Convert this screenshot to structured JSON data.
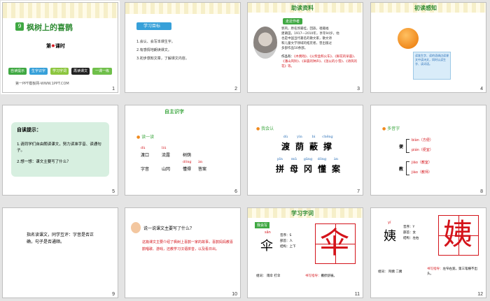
{
  "slides": [
    {
      "number": "1",
      "title_num": "9",
      "title": "枫树上的喜鹊",
      "lesson_pre": "第",
      "lesson_post": "课时",
      "leaf_icon": "maple-leaf-icon",
      "nav": [
        "自读提示",
        "生字识字",
        "学习字词",
        "再读课文",
        "一课一练"
      ],
      "footer": "第一PPT模板网-WWW.1PPT.COM"
    },
    {
      "number": "2",
      "heading": "学习目标",
      "lines": [
        "1.会认、会写本课生字。",
        "2.有感情地朗读课文。",
        "3.初步感知文章，了解课文内容。"
      ]
    },
    {
      "number": "3",
      "header": "助读资料",
      "tag": "走近作者",
      "bio": [
        "郭风，原名郭嘉桂，回族，祖籍福",
        "建莆田，1917—2010年，享年94岁，他",
        "也是中国当代著名的散文家，散文诗",
        "和儿童文学领域的拓荒者，曾出版过",
        "多部作品50余部。"
      ],
      "works_label": "作品有：",
      "works": "《木偶戏》、《火柴盒和火车》、《鲜花的早晨》、《潘山风铃》、《早晨的钟声》、《温以的小雪》、《诗风的花》等。"
    },
    {
      "number": "4",
      "header": "初读感知",
      "note": "读准生字、读的语调边读课文中读诗文，同时认读生字、读词语。"
    },
    {
      "number": "5",
      "heading": "自读提示：",
      "lines": [
        "1.请同学们自由朗读课文，努力读准字音、读通句子。",
        "2.想一想：课文主要写了什么？"
      ]
    },
    {
      "number": "6",
      "heading": "自主识字",
      "tag": "读一读",
      "row1": [
        {
          "py": "dù",
          "hz": "渡口"
        },
        {
          "py": "liú",
          "hz": "流露"
        },
        {
          "py": "",
          "hz": "树荫"
        }
      ],
      "row2": [
        {
          "py": "",
          "hz": "字音"
        },
        {
          "py": "",
          "hz": "山冈"
        },
        {
          "py": "dǒng",
          "hz": "懂得"
        },
        {
          "py": "àn",
          "hz": "答案"
        }
      ]
    },
    {
      "number": "7",
      "tag": "我会认",
      "py1": [
        "dù",
        "yìn",
        "bì",
        "chēng"
      ],
      "hz1": [
        "渡",
        "荫",
        "蔽",
        "撑"
      ],
      "py2": [
        "pīn",
        "mǔ",
        "gāng",
        "dǒng",
        "àn"
      ],
      "hz2": [
        "拼",
        "母",
        "冈",
        "懂",
        "案"
      ]
    },
    {
      "number": "8",
      "tag": "多音字",
      "groups": [
        {
          "char": "便",
          "items": [
            "biàn（方便）",
            "pián（便宜）"
          ]
        },
        {
          "char": "教",
          "items": [
            "jiāo（教室）",
            "jiào（教师）"
          ]
        }
      ]
    },
    {
      "number": "9",
      "text": "指名读课文，同学互评：字音是否正确，句子是否通顺。"
    },
    {
      "number": "10",
      "heading": "说一说课文主要写了什么？",
      "body": "这篇课文主要介绍了枫树上喜鹊一家的故事，喜鹊妈妈教喜鹊唱歌、游戏，还教学习汉语拼音，以及看日出。"
    },
    {
      "number": "11",
      "header": "学习字词",
      "tag": "我会写",
      "py": "sǎn",
      "char": "伞",
      "info": [
        "音序：S",
        "部首：人",
        "结构：上下"
      ],
      "words_label": "组词：",
      "words": "雨伞  打伞",
      "tip_label": "书写指导：",
      "tip": "撇捺舒展。"
    },
    {
      "number": "12",
      "py": "yí",
      "char": "姨",
      "info": [
        "音序：Y",
        "部首：女",
        "结构：左右"
      ],
      "words_label": "组词：",
      "words": "阿姨  二姨",
      "tip_label": "书写指导：",
      "tip": "左窄右宽，第三笔横不出头。"
    }
  ],
  "colors": {
    "green": "#3fa842",
    "red": "#d4141b",
    "orange": "#f08a1e",
    "blue": "#2a6fb7"
  }
}
